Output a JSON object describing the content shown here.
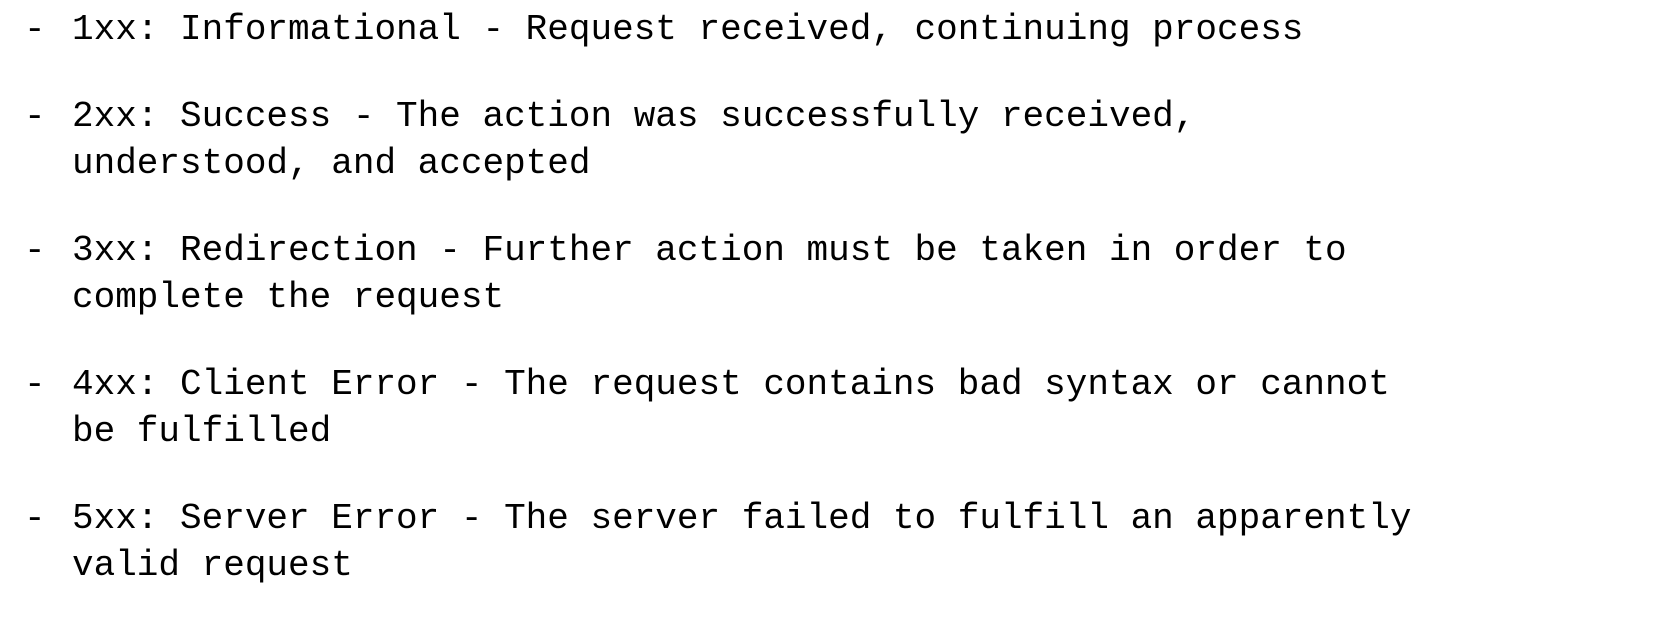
{
  "list": {
    "items": [
      {
        "marker": "-",
        "text": "1xx: Informational - Request received, continuing process"
      },
      {
        "marker": "-",
        "text": "2xx: Success - The action was successfully received,\nunderstood, and accepted"
      },
      {
        "marker": "-",
        "text": "3xx: Redirection - Further action must be taken in order to\ncomplete the request"
      },
      {
        "marker": "-",
        "text": "4xx: Client Error - The request contains bad syntax or cannot\nbe fulfilled"
      },
      {
        "marker": "-",
        "text": "5xx: Server Error - The server failed to fulfill an apparently\nvalid request"
      }
    ]
  }
}
